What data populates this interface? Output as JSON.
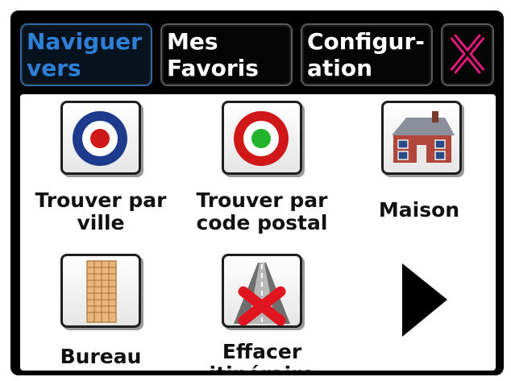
{
  "tabs": {
    "navigate": {
      "line1": "Naviguer",
      "line2": "vers",
      "active": true
    },
    "favorites": {
      "line1": "Mes",
      "line2": "Favoris"
    },
    "configuration": {
      "line1": "Configur-",
      "line2": "ation"
    },
    "close": {
      "icon": "close-x-icon",
      "color": "#e0197d"
    }
  },
  "menu": {
    "items": [
      {
        "line1": "Trouver par",
        "line2": "ville",
        "icon": "target-red-center-icon"
      },
      {
        "line1": "Trouver par",
        "line2": "code postal",
        "icon": "target-green-center-icon"
      },
      {
        "line1": "Maison",
        "line2": "",
        "icon": "house-icon"
      },
      {
        "line1": "Bureau",
        "line2": "",
        "icon": "office-building-icon"
      },
      {
        "line1": "Effacer",
        "line2": "itinéraire",
        "icon": "delete-route-icon"
      }
    ],
    "next_icon": "next-page-arrow-icon"
  },
  "colors": {
    "active_tab_text": "#2e7fd6",
    "target_outer_blue": "#1d3a8c",
    "target_outer_red": "#d01818",
    "target_center_green": "#22b52c",
    "delete_cross": "#e0151f"
  }
}
